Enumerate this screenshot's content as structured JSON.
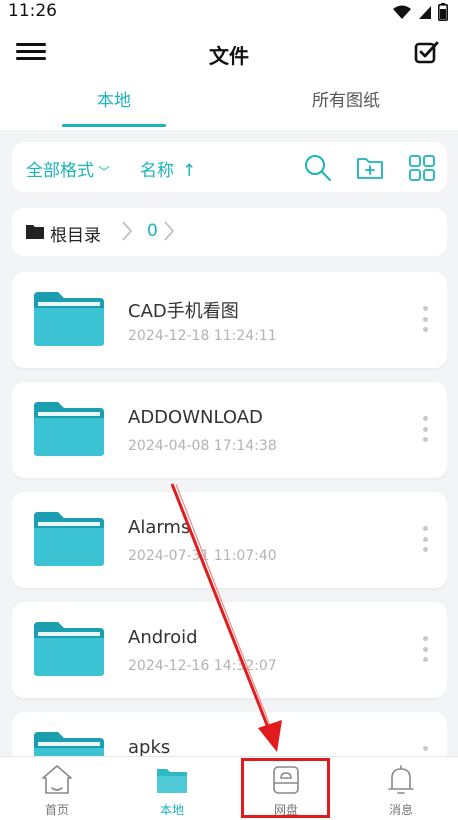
{
  "status_bar": {
    "time": "11:26"
  },
  "header": {
    "title": "文件"
  },
  "tabs": [
    {
      "label": "本地",
      "active": true
    },
    {
      "label": "所有图纸",
      "active": false
    }
  ],
  "toolbar": {
    "filter_label": "全部格式",
    "sort_label": "名称",
    "sort_arrow": "↑"
  },
  "breadcrumb": {
    "root": "根目录",
    "count": "0"
  },
  "files": [
    {
      "name": "CAD手机看图",
      "date": "2024-12-18 11:24:11"
    },
    {
      "name": "ADDOWNLOAD",
      "date": "2024-04-08 17:14:38"
    },
    {
      "name": "Alarms",
      "date": "2024-07-31 11:07:40"
    },
    {
      "name": "Android",
      "date": "2024-12-16 14:32:07"
    },
    {
      "name": "apks",
      "date": ""
    }
  ],
  "bottom_nav": [
    {
      "label": "首页",
      "icon": "home-icon",
      "active": false
    },
    {
      "label": "本地",
      "icon": "folder-icon",
      "active": true
    },
    {
      "label": "网盘",
      "icon": "cloud-drive-icon",
      "active": false
    },
    {
      "label": "消息",
      "icon": "bell-icon",
      "active": false
    }
  ],
  "colors": {
    "accent": "#1bb3bc",
    "annotation": "#e11b1b",
    "background": "#f3f4f6"
  }
}
